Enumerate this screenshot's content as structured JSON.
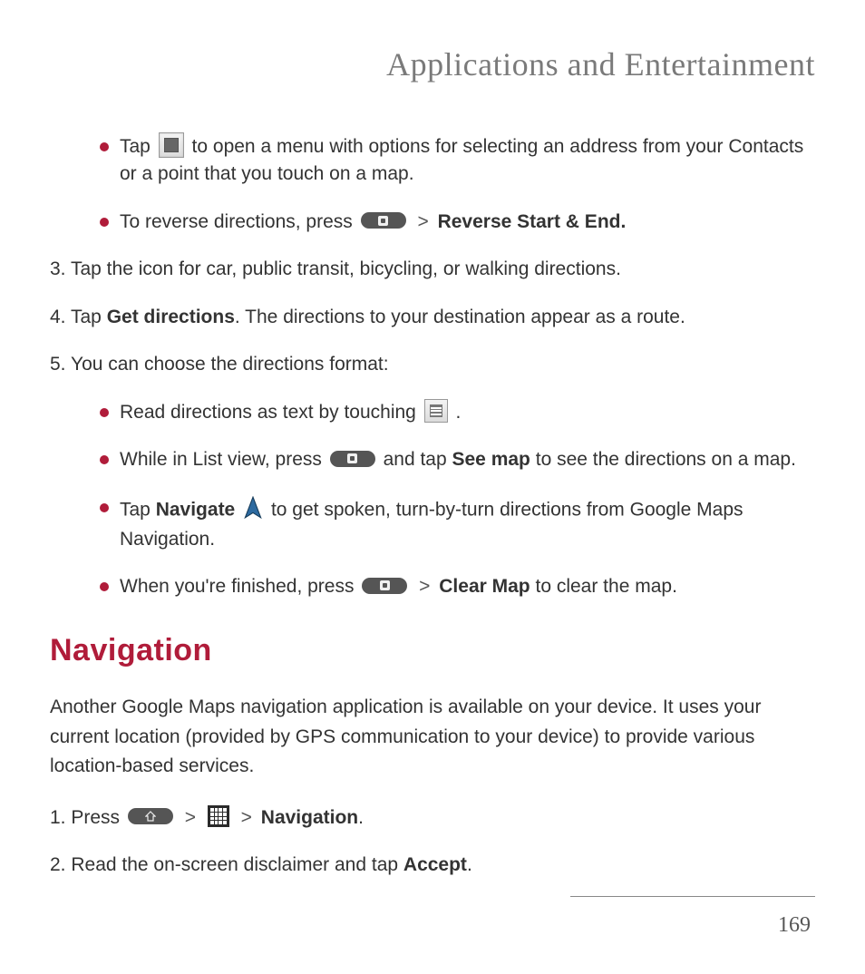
{
  "header": {
    "title": "Applications and Entertainment"
  },
  "bullets_top": [
    {
      "pre": "Tap ",
      "post": " to open a menu with options for selecting an address from your Contacts or a point that you touch on a map."
    },
    {
      "pre": "To reverse directions, press ",
      "sep": " > ",
      "bold": "Reverse Start & End."
    }
  ],
  "steps_mid": [
    {
      "num": "3.",
      "text": "Tap the icon for car, public transit, bicycling, or walking directions."
    },
    {
      "num": "4.",
      "pre": "Tap ",
      "bold": "Get directions",
      "post": ". The directions to your destination appear as a route."
    },
    {
      "num": "5.",
      "text": "You can choose the directions format:"
    }
  ],
  "bullets_format": [
    {
      "pre": "Read directions as text by touching ",
      "post": " ."
    },
    {
      "pre": "While in List view, press ",
      "mid": " and tap ",
      "bold": "See map",
      "post": " to see the directions on a map."
    },
    {
      "pre": "Tap ",
      "bold": "Navigate",
      "mid_after_icon": " to get spoken, turn-by-turn directions from Google Maps Navigation."
    },
    {
      "pre": "When you're finished, press ",
      "sep": " > ",
      "bold": "Clear Map",
      "post": " to clear the map."
    }
  ],
  "navigation": {
    "heading": "Navigation",
    "intro": "Another Google Maps navigation application is available on your device. It uses your current location (provided by GPS communication to your device) to provide various location-based services.",
    "steps": [
      {
        "num": "1.",
        "pre": "Press ",
        "sep1": " > ",
        "sep2": " > ",
        "bold": "Navigation",
        "post": "."
      },
      {
        "num": "2.",
        "pre": "Read the on-screen disclaimer and tap ",
        "bold": "Accept",
        "post": "."
      }
    ]
  },
  "page_number": "169"
}
